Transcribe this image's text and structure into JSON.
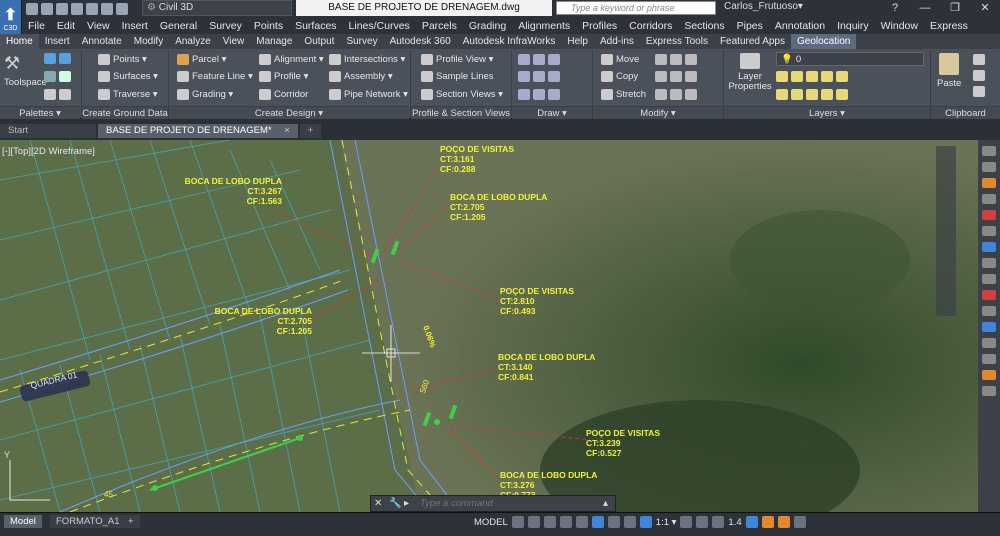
{
  "title": {
    "app_badge": "C3D",
    "workspace": "Civil 3D",
    "filename": "BASE DE PROJETO DE DRENAGEM.dwg",
    "search_placeholder": "Type a keyword or phrase",
    "user": "Carlos_Frutuoso▾",
    "help": "?"
  },
  "menu": [
    "File",
    "Edit",
    "View",
    "Insert",
    "General",
    "Survey",
    "Points",
    "Surfaces",
    "Lines/Curves",
    "Parcels",
    "Grading",
    "Alignments",
    "Profiles",
    "Corridors",
    "Sections",
    "Pipes",
    "Annotation",
    "Inquiry",
    "Window",
    "Express"
  ],
  "tabs": [
    "Home",
    "Insert",
    "Annotate",
    "Modify",
    "Analyze",
    "View",
    "Manage",
    "Output",
    "Survey",
    "Autodesk 360",
    "Autodesk InfraWorks",
    "Help",
    "Add-ins",
    "Express Tools",
    "Featured Apps",
    "Geolocation"
  ],
  "ribbon": {
    "toolspace": "Toolspace",
    "palettes": "Palettes ▾",
    "ground": {
      "title": "Create Ground Data ▾",
      "points": "Points ▾",
      "surfaces": "Surfaces ▾",
      "traverse": "Traverse ▾"
    },
    "design": {
      "title": "Create Design ▾",
      "parcel": "Parcel ▾",
      "feature_line": "Feature Line ▾",
      "grading": "Grading ▾",
      "alignment": "Alignment ▾",
      "profile": "Profile ▾",
      "corridor": "Corridor",
      "intersections": "Intersections ▾",
      "assembly": "Assembly ▾",
      "pipe_network": "Pipe Network ▾"
    },
    "profile_section": {
      "title": "Profile & Section Views",
      "profile_view": "Profile View ▾",
      "sample_lines": "Sample Lines",
      "section_views": "Section Views ▾"
    },
    "draw": {
      "title": "Draw ▾"
    },
    "modify": {
      "title": "Modify ▾",
      "move": "Move",
      "copy": "Copy",
      "stretch": "Stretch"
    },
    "layers": {
      "title": "Layers ▾",
      "layer_properties": "Layer Properties",
      "layer_value": "0"
    },
    "clipboard": {
      "title": "Clipboard",
      "paste": "Paste"
    }
  },
  "doctabs": {
    "start": "Start",
    "active": "BASE DE PROJETO DE DRENAGEM*",
    "close": "×",
    "add": "+"
  },
  "viewport": {
    "label": "[-][Top][2D Wireframe]"
  },
  "annotations": [
    {
      "t": "POÇO DE VISITAS",
      "a": "CT:3.161",
      "b": "CF:0.288"
    },
    {
      "t": "BOCA DE LOBO DUPLA",
      "a": "CT:3.267",
      "b": "CF:1.563"
    },
    {
      "t": "BOCA DE LOBO DUPLA",
      "a": "CT:2.705",
      "b": "CF:1.205"
    },
    {
      "t": "POÇO DE VISITAS",
      "a": "CT:2.810",
      "b": "CF:0.493"
    },
    {
      "t": "BOCA DE LOBO DUPLA",
      "a": "CT:2.705",
      "b": "CF:1.205"
    },
    {
      "t": "BOCA DE LOBO DUPLA",
      "a": "CT:3.140",
      "b": "CF:0.841"
    },
    {
      "t": "POÇO DE VISITAS",
      "a": "CT:3.239",
      "b": "CF:0.527"
    },
    {
      "t": "BOCA DE LOBO DUPLA",
      "a": "CT:3.276",
      "b": "CF:0.773"
    }
  ],
  "map_labels": {
    "quadra": "QUADRA 01",
    "slope": "0.06%",
    "station": "560",
    "num": "45"
  },
  "cmdline": {
    "placeholder": "Type a command"
  },
  "status": {
    "model_tab": "Model",
    "layout_tab": "FORMATO_A1",
    "add": "+",
    "model": "MODEL",
    "scale": "1:1 ▾",
    "zoom": "1.4"
  }
}
